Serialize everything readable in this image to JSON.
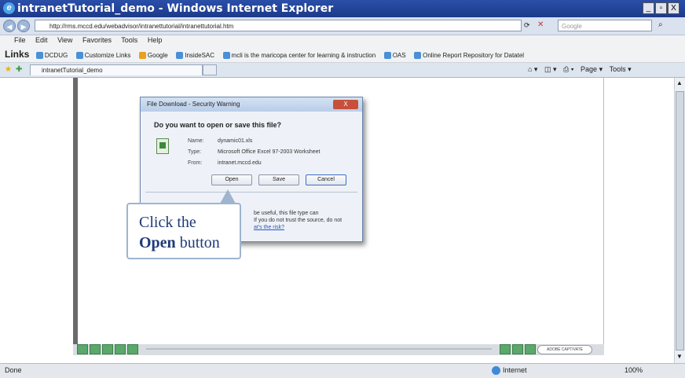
{
  "window": {
    "title": "intranetTutorial_demo - Windows Internet Explorer",
    "controls": [
      "_",
      "▫",
      "X"
    ]
  },
  "address": {
    "url": "http://rms.mccd.edu/webadvisor/intranettutorial/intranettutorial.htm",
    "search_placeholder": "Google"
  },
  "menu": [
    "File",
    "Edit",
    "View",
    "Favorites",
    "Tools",
    "Help"
  ],
  "links_bar": {
    "label": "Links",
    "items": [
      "DCDUG",
      "Customize Links",
      "Google",
      "InsideSAC",
      "mcli is the maricopa center for learning & instruction",
      "OAS",
      "Online Report Repository for Datatel"
    ]
  },
  "tab": {
    "title": "intranetTutorial_demo",
    "tools": [
      "Page",
      "Tools"
    ]
  },
  "dialog": {
    "title": "File Download - Security Warning",
    "close": "X",
    "question": "Do you want to open or save this file?",
    "name_label": "Name:",
    "name_value": "dynamic01.xls",
    "type_label": "Type:",
    "type_value": "Microsoft Office Excel 97-2003 Worksheet",
    "from_label": "From:",
    "from_value": "intranet.mccd.edu",
    "open_button": "Open",
    "save_button": "Save",
    "cancel_button": "Cancel",
    "warning_line1": "be useful, this file type can",
    "warning_line2": "If you do not trust the source, do not",
    "warning_link": "at's the risk?"
  },
  "callout": {
    "line1": "Click the",
    "bold": "Open",
    "rest": " button"
  },
  "captivate": {
    "adobe_label": "ADOBE CAPTIVATE"
  },
  "status": {
    "text": "Done",
    "zone": "Internet",
    "zoom": "100%"
  }
}
